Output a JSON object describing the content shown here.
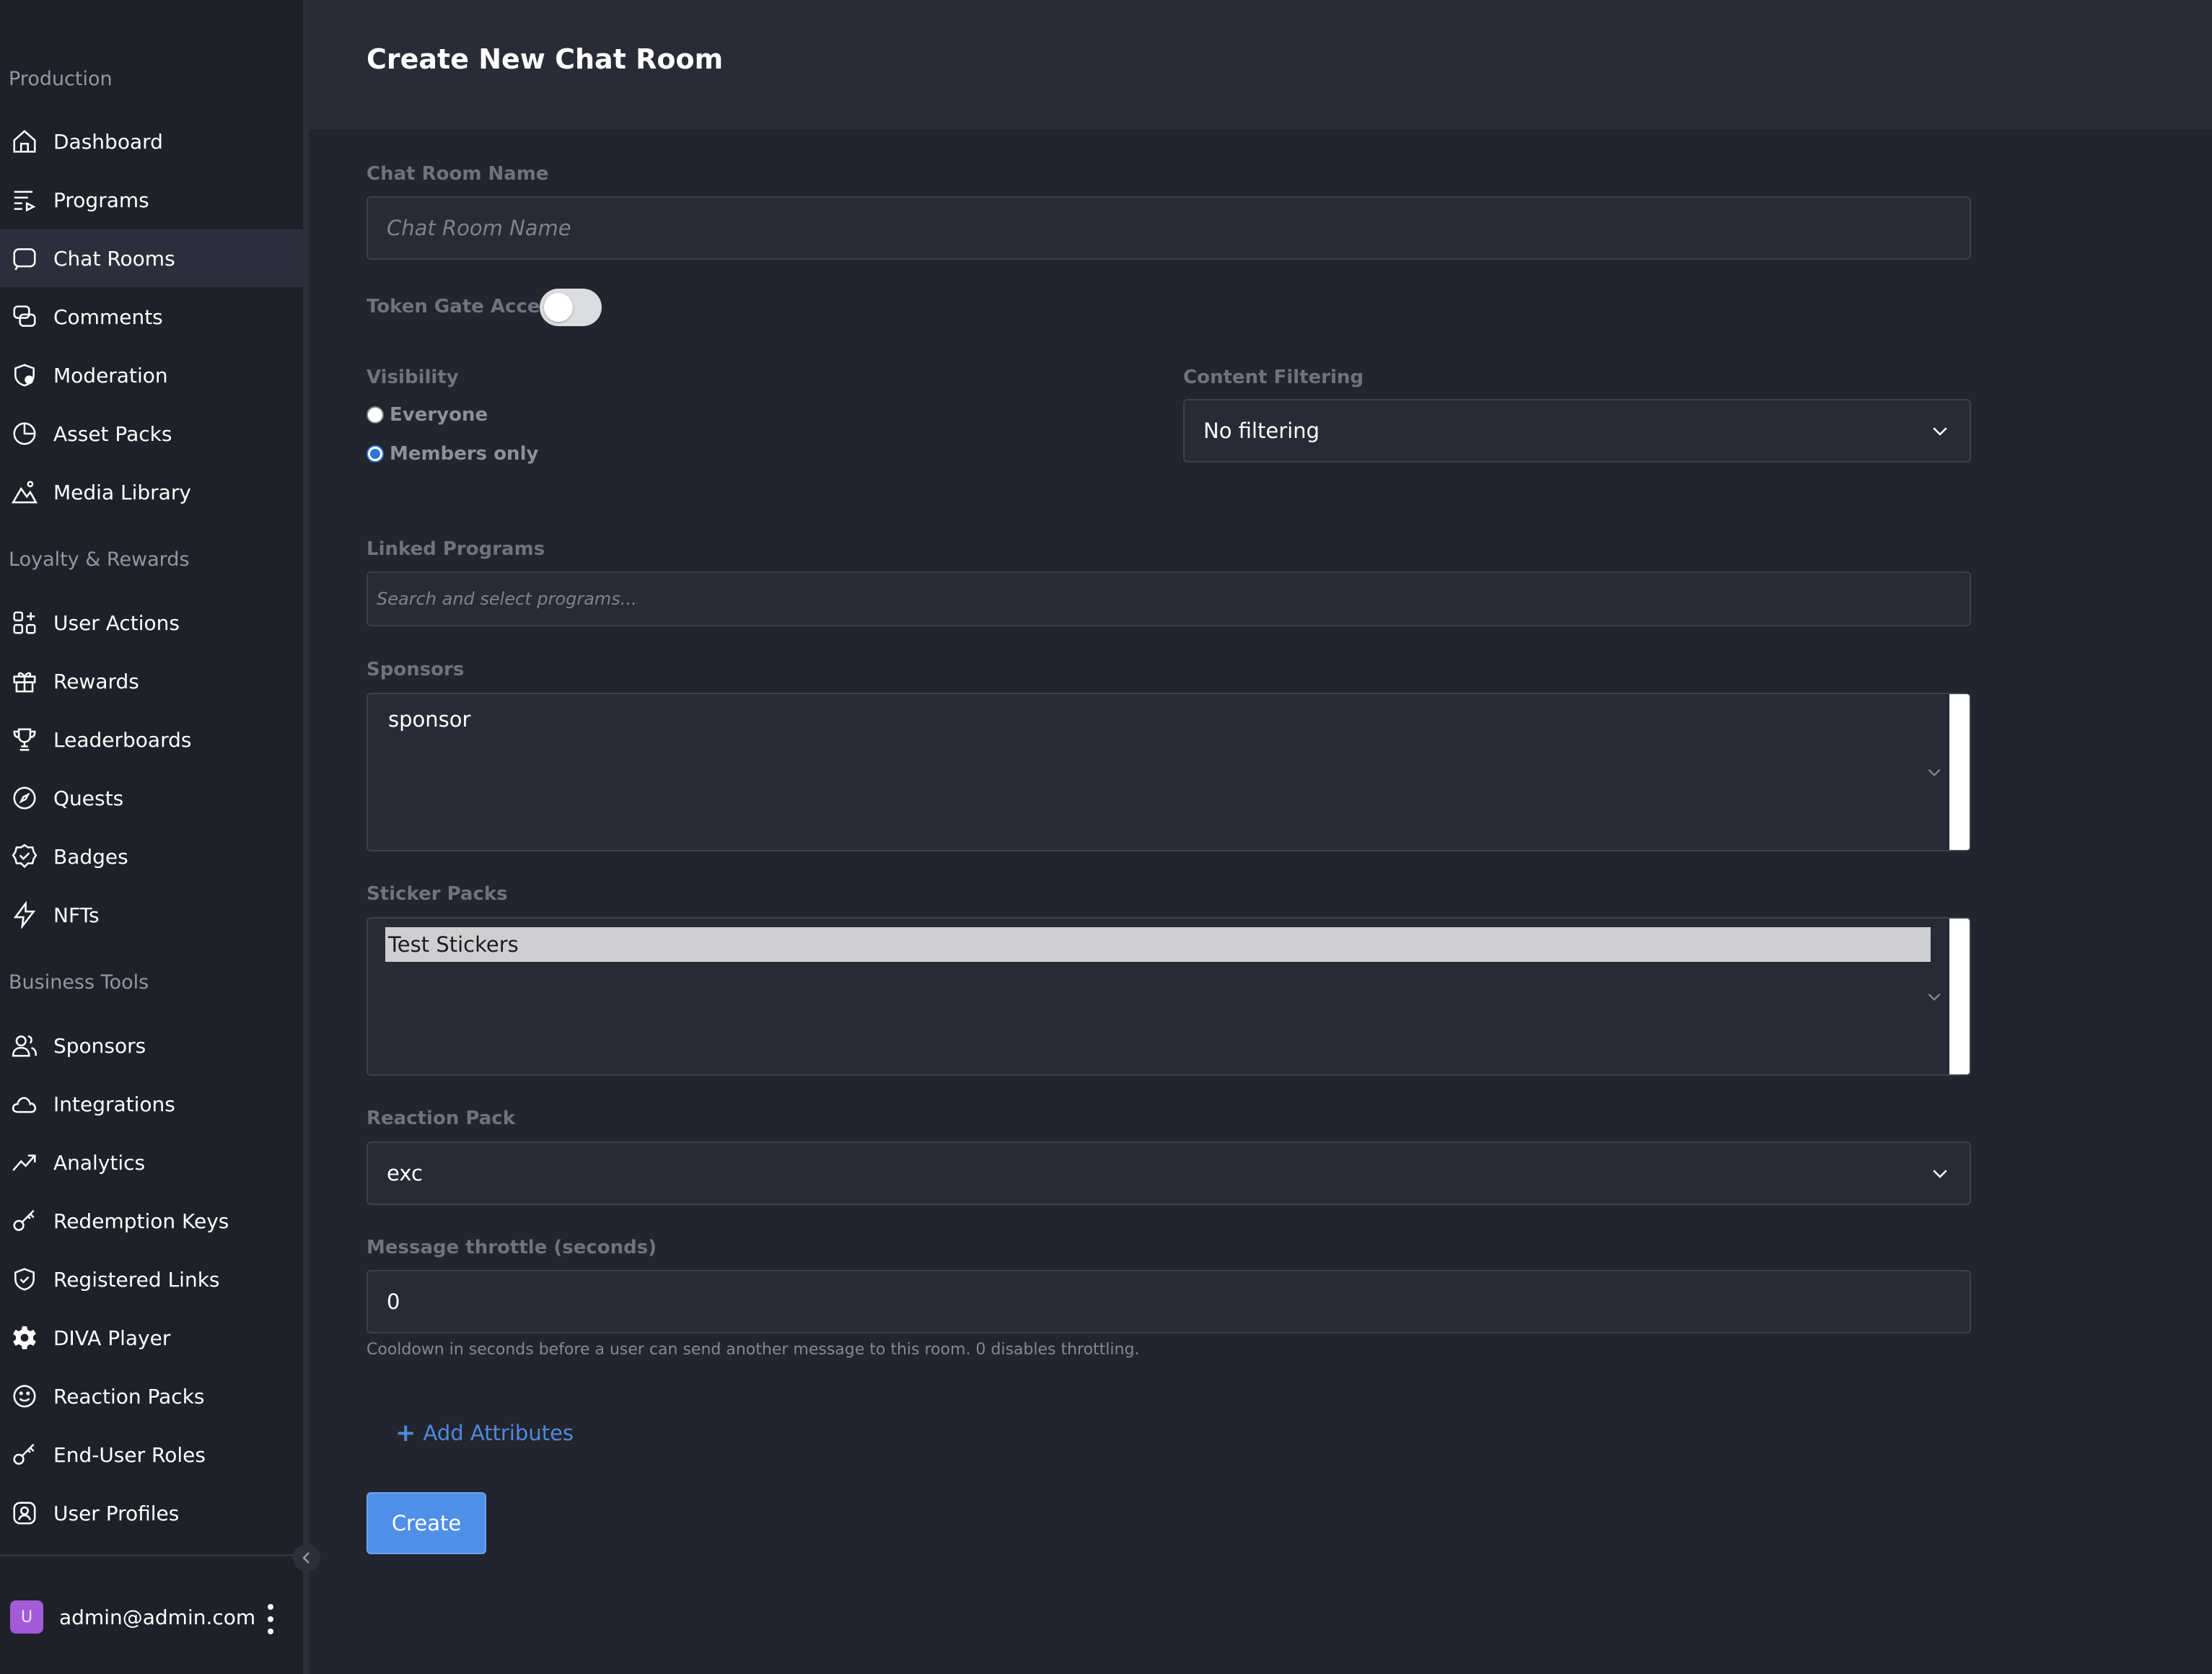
{
  "sidebar": {
    "sections": [
      {
        "title": "Production"
      },
      {
        "title": "Loyalty & Rewards"
      },
      {
        "title": "Business Tools"
      }
    ],
    "items": [
      {
        "label": "Dashboard",
        "icon": "home-icon"
      },
      {
        "label": "Programs",
        "icon": "playlist-icon"
      },
      {
        "label": "Chat Rooms",
        "icon": "chat-bubble-icon",
        "active": true
      },
      {
        "label": "Comments",
        "icon": "comments-icon"
      },
      {
        "label": "Moderation",
        "icon": "shield-icon"
      },
      {
        "label": "Asset Packs",
        "icon": "pie-icon"
      },
      {
        "label": "Media Library",
        "icon": "landscape-icon"
      },
      {
        "label": "User Actions",
        "icon": "grid-plus-icon"
      },
      {
        "label": "Rewards",
        "icon": "gift-icon"
      },
      {
        "label": "Leaderboards",
        "icon": "trophy-icon"
      },
      {
        "label": "Quests",
        "icon": "compass-icon"
      },
      {
        "label": "Badges",
        "icon": "badge-check-icon"
      },
      {
        "label": "NFTs",
        "icon": "lightning-icon"
      },
      {
        "label": "Sponsors",
        "icon": "users-icon"
      },
      {
        "label": "Integrations",
        "icon": "cloud-icon"
      },
      {
        "label": "Analytics",
        "icon": "trend-up-icon"
      },
      {
        "label": "Redemption Keys",
        "icon": "key-icon"
      },
      {
        "label": "Registered Links",
        "icon": "shield-check-icon"
      },
      {
        "label": "DIVA Player",
        "icon": "gear-icon"
      },
      {
        "label": "Reaction Packs",
        "icon": "smiley-icon"
      },
      {
        "label": "End-User Roles",
        "icon": "key-icon"
      },
      {
        "label": "User Profiles",
        "icon": "user-badge-icon"
      }
    ],
    "user": {
      "avatar_letter": "U",
      "email": "admin@admin.com"
    }
  },
  "page": {
    "title": "Create New Chat Room"
  },
  "form": {
    "name": {
      "label": "Chat Room Name",
      "placeholder": "Chat Room Name",
      "value": ""
    },
    "token_gate": {
      "label": "Token Gate Access",
      "enabled": false
    },
    "visibility": {
      "label": "Visibility",
      "options": [
        {
          "label": "Everyone",
          "checked": false
        },
        {
          "label": "Members only",
          "checked": true
        }
      ]
    },
    "content_filtering": {
      "label": "Content Filtering",
      "value": "No filtering"
    },
    "linked_programs": {
      "label": "Linked Programs",
      "placeholder": "Search and select programs..."
    },
    "sponsors": {
      "label": "Sponsors",
      "options": [
        "sponsor"
      ]
    },
    "sticker_packs": {
      "label": "Sticker Packs",
      "options": [
        "Test Stickers"
      ]
    },
    "reaction_pack": {
      "label": "Reaction Pack",
      "value": "exc"
    },
    "throttle": {
      "label": "Message throttle (seconds)",
      "value": "0",
      "hint": "Cooldown in seconds before a user can send another message to this room. 0 disables throttling."
    },
    "add_attributes_label": "Add Attributes",
    "create_label": "Create"
  },
  "colors": {
    "sidebar_bg": "#1f2129",
    "main_bg": "#22252e",
    "header_bg": "#292c37",
    "accent": "#4f8fe8",
    "link": "#4f8ad9",
    "avatar": "#a35bd9"
  }
}
